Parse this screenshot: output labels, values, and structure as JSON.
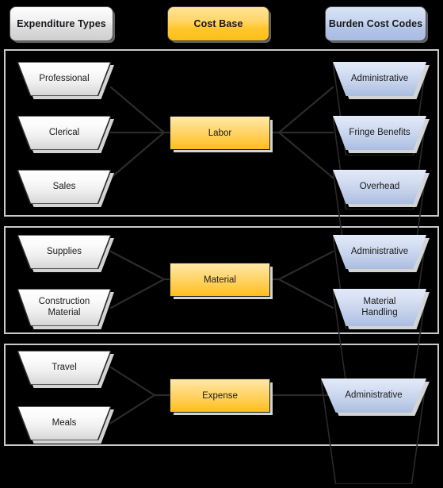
{
  "columns": {
    "expenditure": {
      "label": "Expenditure Types",
      "color": "#e8e8e8"
    },
    "cost_base": {
      "label": "Cost Base",
      "color": "#ffc72e"
    },
    "burden": {
      "label": "Burden Cost Codes",
      "color": "#b2c4e6"
    }
  },
  "sections": [
    {
      "name": "labor",
      "cost_base": "Labor",
      "expenditure_types": [
        "Professional",
        "Clerical",
        "Sales"
      ],
      "burden_cost_codes": [
        "Administrative",
        "Fringe Benefits",
        "Overhead"
      ]
    },
    {
      "name": "material",
      "cost_base": "Material",
      "expenditure_types": [
        "Supplies",
        "Construction\nMaterial"
      ],
      "burden_cost_codes": [
        "Administrative",
        "Material\nHandling"
      ]
    },
    {
      "name": "expense",
      "cost_base": "Expense",
      "expenditure_types": [
        "Travel",
        "Meals"
      ],
      "burden_cost_codes": [
        "Administrative"
      ]
    }
  ],
  "colors": {
    "background": "#000000",
    "panel_border": "#c9c9c9",
    "connector": "#2b2b2b",
    "expenditure_fill": "#efefef",
    "cost_base_fill": "#ffd05a",
    "burden_fill": "#c6d3ec"
  }
}
